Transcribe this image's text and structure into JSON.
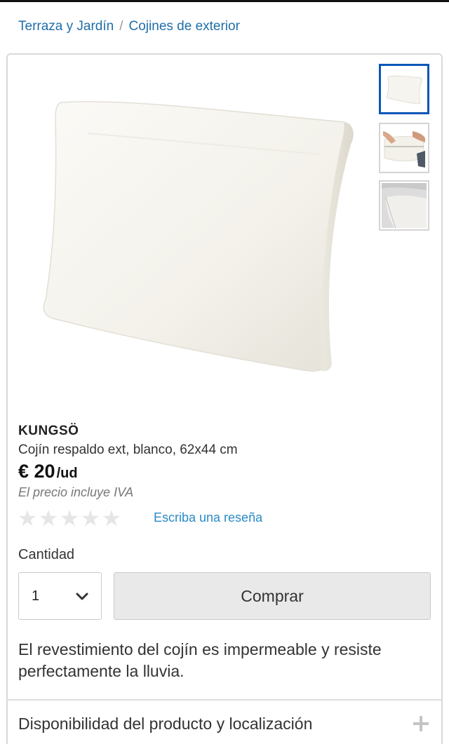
{
  "breadcrumb": {
    "items": [
      {
        "label": "Terraza y Jardín"
      },
      {
        "label": "Cojines de exterior"
      }
    ],
    "separator": "/"
  },
  "product": {
    "name": "KUNGSÖ",
    "description": "Cojín respaldo ext, blanco, 62x44 cm",
    "price_amount": "€ 20",
    "price_unit": "/ud",
    "vat_note": "El precio incluye IVA",
    "rating": {
      "stars_total": 5,
      "stars_filled": 0,
      "review_link": "Escriba una reseña"
    },
    "images": {
      "main": "pillow-main-image",
      "thumbnails": [
        {
          "name": "pillow-front-thumbnail",
          "active": true
        },
        {
          "name": "pillow-hands-thumbnail",
          "active": false
        },
        {
          "name": "pillow-corner-thumbnail",
          "active": false
        }
      ]
    }
  },
  "purchase": {
    "quantity_label": "Cantidad",
    "quantity_value": "1",
    "buy_label": "Comprar"
  },
  "details": {
    "text": "El revestimiento del cojín es impermeable y resiste perfectamente la lluvia.",
    "availability_label": "Disponibilidad del producto y localización"
  },
  "colors": {
    "link": "#1f6fa8",
    "active_thumb_border": "#0a57b8",
    "button_bg": "#e9e9e9"
  },
  "icons": {
    "star": "star-icon",
    "chevron": "chevron-down-icon",
    "plus": "plus-icon"
  }
}
